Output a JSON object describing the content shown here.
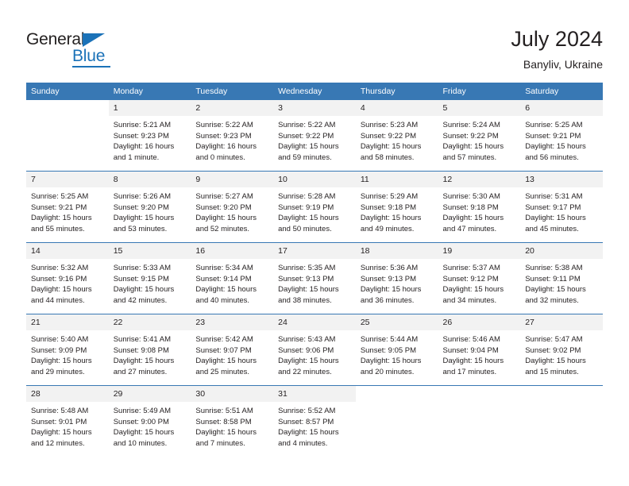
{
  "logo": {
    "word_general": "General",
    "word_blue": "Blue",
    "triangle_color": "#1b72b8"
  },
  "header": {
    "title": "July 2024",
    "subtitle": "Banyliv, Ukraine"
  },
  "theme": {
    "header_bg": "#3878b4",
    "daynum_bg": "#f2f2f2",
    "rule_color": "#3878b4",
    "text_color": "#231f20"
  },
  "weekday_headers": [
    "Sunday",
    "Monday",
    "Tuesday",
    "Wednesday",
    "Thursday",
    "Friday",
    "Saturday"
  ],
  "weeks": [
    [
      {
        "day": "",
        "sunrise": "",
        "sunset": "",
        "daylight_line1": "",
        "daylight_line2": ""
      },
      {
        "day": "1",
        "sunrise": "Sunrise: 5:21 AM",
        "sunset": "Sunset: 9:23 PM",
        "daylight_line1": "Daylight: 16 hours",
        "daylight_line2": "and 1 minute."
      },
      {
        "day": "2",
        "sunrise": "Sunrise: 5:22 AM",
        "sunset": "Sunset: 9:23 PM",
        "daylight_line1": "Daylight: 16 hours",
        "daylight_line2": "and 0 minutes."
      },
      {
        "day": "3",
        "sunrise": "Sunrise: 5:22 AM",
        "sunset": "Sunset: 9:22 PM",
        "daylight_line1": "Daylight: 15 hours",
        "daylight_line2": "and 59 minutes."
      },
      {
        "day": "4",
        "sunrise": "Sunrise: 5:23 AM",
        "sunset": "Sunset: 9:22 PM",
        "daylight_line1": "Daylight: 15 hours",
        "daylight_line2": "and 58 minutes."
      },
      {
        "day": "5",
        "sunrise": "Sunrise: 5:24 AM",
        "sunset": "Sunset: 9:22 PM",
        "daylight_line1": "Daylight: 15 hours",
        "daylight_line2": "and 57 minutes."
      },
      {
        "day": "6",
        "sunrise": "Sunrise: 5:25 AM",
        "sunset": "Sunset: 9:21 PM",
        "daylight_line1": "Daylight: 15 hours",
        "daylight_line2": "and 56 minutes."
      }
    ],
    [
      {
        "day": "7",
        "sunrise": "Sunrise: 5:25 AM",
        "sunset": "Sunset: 9:21 PM",
        "daylight_line1": "Daylight: 15 hours",
        "daylight_line2": "and 55 minutes."
      },
      {
        "day": "8",
        "sunrise": "Sunrise: 5:26 AM",
        "sunset": "Sunset: 9:20 PM",
        "daylight_line1": "Daylight: 15 hours",
        "daylight_line2": "and 53 minutes."
      },
      {
        "day": "9",
        "sunrise": "Sunrise: 5:27 AM",
        "sunset": "Sunset: 9:20 PM",
        "daylight_line1": "Daylight: 15 hours",
        "daylight_line2": "and 52 minutes."
      },
      {
        "day": "10",
        "sunrise": "Sunrise: 5:28 AM",
        "sunset": "Sunset: 9:19 PM",
        "daylight_line1": "Daylight: 15 hours",
        "daylight_line2": "and 50 minutes."
      },
      {
        "day": "11",
        "sunrise": "Sunrise: 5:29 AM",
        "sunset": "Sunset: 9:18 PM",
        "daylight_line1": "Daylight: 15 hours",
        "daylight_line2": "and 49 minutes."
      },
      {
        "day": "12",
        "sunrise": "Sunrise: 5:30 AM",
        "sunset": "Sunset: 9:18 PM",
        "daylight_line1": "Daylight: 15 hours",
        "daylight_line2": "and 47 minutes."
      },
      {
        "day": "13",
        "sunrise": "Sunrise: 5:31 AM",
        "sunset": "Sunset: 9:17 PM",
        "daylight_line1": "Daylight: 15 hours",
        "daylight_line2": "and 45 minutes."
      }
    ],
    [
      {
        "day": "14",
        "sunrise": "Sunrise: 5:32 AM",
        "sunset": "Sunset: 9:16 PM",
        "daylight_line1": "Daylight: 15 hours",
        "daylight_line2": "and 44 minutes."
      },
      {
        "day": "15",
        "sunrise": "Sunrise: 5:33 AM",
        "sunset": "Sunset: 9:15 PM",
        "daylight_line1": "Daylight: 15 hours",
        "daylight_line2": "and 42 minutes."
      },
      {
        "day": "16",
        "sunrise": "Sunrise: 5:34 AM",
        "sunset": "Sunset: 9:14 PM",
        "daylight_line1": "Daylight: 15 hours",
        "daylight_line2": "and 40 minutes."
      },
      {
        "day": "17",
        "sunrise": "Sunrise: 5:35 AM",
        "sunset": "Sunset: 9:13 PM",
        "daylight_line1": "Daylight: 15 hours",
        "daylight_line2": "and 38 minutes."
      },
      {
        "day": "18",
        "sunrise": "Sunrise: 5:36 AM",
        "sunset": "Sunset: 9:13 PM",
        "daylight_line1": "Daylight: 15 hours",
        "daylight_line2": "and 36 minutes."
      },
      {
        "day": "19",
        "sunrise": "Sunrise: 5:37 AM",
        "sunset": "Sunset: 9:12 PM",
        "daylight_line1": "Daylight: 15 hours",
        "daylight_line2": "and 34 minutes."
      },
      {
        "day": "20",
        "sunrise": "Sunrise: 5:38 AM",
        "sunset": "Sunset: 9:11 PM",
        "daylight_line1": "Daylight: 15 hours",
        "daylight_line2": "and 32 minutes."
      }
    ],
    [
      {
        "day": "21",
        "sunrise": "Sunrise: 5:40 AM",
        "sunset": "Sunset: 9:09 PM",
        "daylight_line1": "Daylight: 15 hours",
        "daylight_line2": "and 29 minutes."
      },
      {
        "day": "22",
        "sunrise": "Sunrise: 5:41 AM",
        "sunset": "Sunset: 9:08 PM",
        "daylight_line1": "Daylight: 15 hours",
        "daylight_line2": "and 27 minutes."
      },
      {
        "day": "23",
        "sunrise": "Sunrise: 5:42 AM",
        "sunset": "Sunset: 9:07 PM",
        "daylight_line1": "Daylight: 15 hours",
        "daylight_line2": "and 25 minutes."
      },
      {
        "day": "24",
        "sunrise": "Sunrise: 5:43 AM",
        "sunset": "Sunset: 9:06 PM",
        "daylight_line1": "Daylight: 15 hours",
        "daylight_line2": "and 22 minutes."
      },
      {
        "day": "25",
        "sunrise": "Sunrise: 5:44 AM",
        "sunset": "Sunset: 9:05 PM",
        "daylight_line1": "Daylight: 15 hours",
        "daylight_line2": "and 20 minutes."
      },
      {
        "day": "26",
        "sunrise": "Sunrise: 5:46 AM",
        "sunset": "Sunset: 9:04 PM",
        "daylight_line1": "Daylight: 15 hours",
        "daylight_line2": "and 17 minutes."
      },
      {
        "day": "27",
        "sunrise": "Sunrise: 5:47 AM",
        "sunset": "Sunset: 9:02 PM",
        "daylight_line1": "Daylight: 15 hours",
        "daylight_line2": "and 15 minutes."
      }
    ],
    [
      {
        "day": "28",
        "sunrise": "Sunrise: 5:48 AM",
        "sunset": "Sunset: 9:01 PM",
        "daylight_line1": "Daylight: 15 hours",
        "daylight_line2": "and 12 minutes."
      },
      {
        "day": "29",
        "sunrise": "Sunrise: 5:49 AM",
        "sunset": "Sunset: 9:00 PM",
        "daylight_line1": "Daylight: 15 hours",
        "daylight_line2": "and 10 minutes."
      },
      {
        "day": "30",
        "sunrise": "Sunrise: 5:51 AM",
        "sunset": "Sunset: 8:58 PM",
        "daylight_line1": "Daylight: 15 hours",
        "daylight_line2": "and 7 minutes."
      },
      {
        "day": "31",
        "sunrise": "Sunrise: 5:52 AM",
        "sunset": "Sunset: 8:57 PM",
        "daylight_line1": "Daylight: 15 hours",
        "daylight_line2": "and 4 minutes."
      },
      {
        "day": "",
        "sunrise": "",
        "sunset": "",
        "daylight_line1": "",
        "daylight_line2": ""
      },
      {
        "day": "",
        "sunrise": "",
        "sunset": "",
        "daylight_line1": "",
        "daylight_line2": ""
      },
      {
        "day": "",
        "sunrise": "",
        "sunset": "",
        "daylight_line1": "",
        "daylight_line2": ""
      }
    ]
  ]
}
